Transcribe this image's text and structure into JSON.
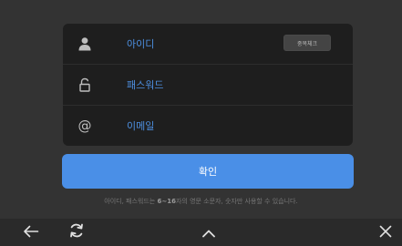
{
  "form": {
    "id_field": {
      "icon": "person-icon",
      "placeholder": "아이디",
      "check_button_label": "중복체크"
    },
    "password_field": {
      "icon": "lock-icon",
      "placeholder": "패스워드"
    },
    "email_field": {
      "icon": "at-sign-icon",
      "icon_glyph": "@",
      "placeholder": "이메일"
    }
  },
  "confirm_button": {
    "label": "확인"
  },
  "hint": {
    "before": "아이디, 패스워드는 ",
    "emphasis": "6~16",
    "after": "자의 영문 소문자, 숫자만 사용할 수 있습니다."
  },
  "navbar": {
    "back_icon": "arrow-left-icon",
    "refresh_icon": "refresh-icon",
    "up_icon": "chevron-up-icon",
    "close_icon": "close-icon"
  },
  "colors": {
    "background": "#333333",
    "card": "#1e1e1e",
    "accent": "#4a8fe7",
    "placeholder": "#4d8fe0",
    "navbar": "#2a2a2a"
  }
}
